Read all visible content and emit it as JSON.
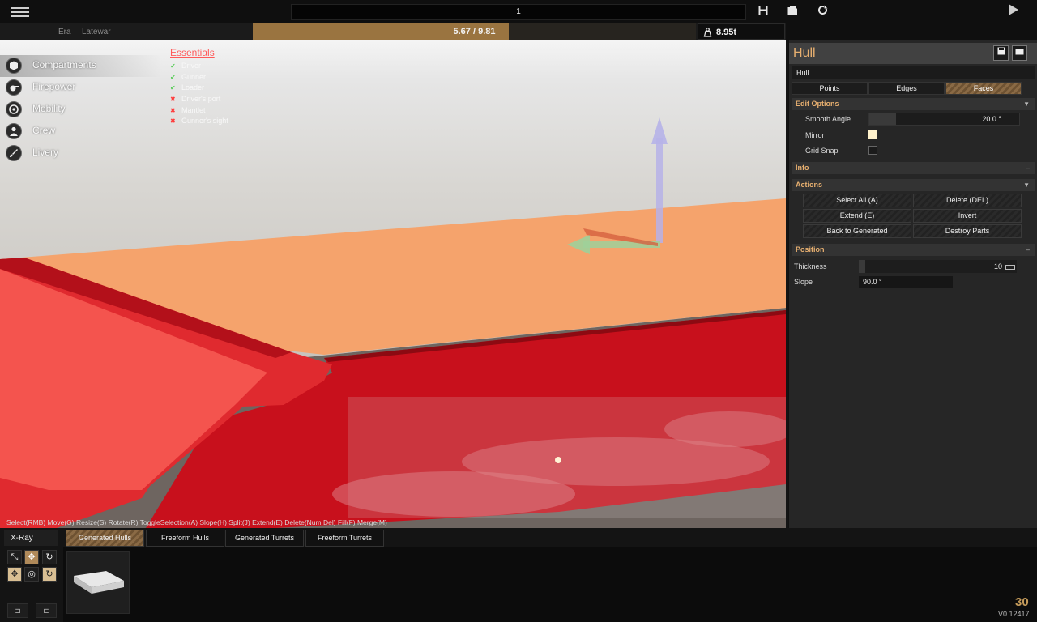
{
  "topbar": {
    "title_value": "1",
    "era_label": "Era",
    "era_value": "Latewar",
    "cost_text": "5.67 / 9.81",
    "cost_fraction": 0.578,
    "weight_text": "8.95t",
    "icons": [
      "menu-icon",
      "save-icon",
      "folder-icon",
      "refresh-icon",
      "play-icon",
      "weight-icon"
    ]
  },
  "left_menu": {
    "items": [
      {
        "label": "Compartments",
        "icon": "compartment-icon",
        "active": true
      },
      {
        "label": "Firepower",
        "icon": "cannon-icon",
        "active": false
      },
      {
        "label": "Mobility",
        "icon": "wheel-icon",
        "active": false
      },
      {
        "label": "Crew",
        "icon": "person-icon",
        "active": false
      },
      {
        "label": "Livery",
        "icon": "brush-icon",
        "active": false
      }
    ]
  },
  "essentials": {
    "title": "Essentials",
    "items": [
      {
        "label": "Driver",
        "ok": true
      },
      {
        "label": "Gunner",
        "ok": true
      },
      {
        "label": "Loader",
        "ok": true
      },
      {
        "label": "Driver's port",
        "ok": false
      },
      {
        "label": "Mantlet",
        "ok": false
      },
      {
        "label": "Gunner's sight",
        "ok": false
      }
    ]
  },
  "hint_bar": "Select(RMB) Move(G) Resize(S) Rotate(R) ToggleSelection(A) Slope(H) Split(J) Extend(E) Delete(Num Del) Fill(F) Merge(M)",
  "panel": {
    "title": "Hull",
    "part_name": "Hull",
    "mode_tabs": [
      "Points",
      "Edges",
      "Faces"
    ],
    "edit_options": {
      "header": "Edit Options",
      "smooth_angle_label": "Smooth Angle",
      "smooth_angle_value": "20.0 °",
      "smooth_angle_fraction": 0.18,
      "mirror_label": "Mirror",
      "mirror_on": true,
      "grid_snap_label": "Grid Snap",
      "grid_snap_on": false
    },
    "info_header": "Info",
    "actions": {
      "header": "Actions",
      "buttons": [
        "Select All (A)",
        "Delete (DEL)",
        "Extend (E)",
        "Invert",
        "Back to Generated",
        "Destroy Parts"
      ]
    },
    "position": {
      "header": "Position",
      "thickness_label": "Thickness",
      "thickness_value": "10",
      "thickness_fraction": 0.04,
      "slope_label": "Slope",
      "slope_value": "90.0 °"
    }
  },
  "bottom": {
    "xray_label": "X-Ray",
    "tabs": [
      "Generated Hulls",
      "Freeform Hulls",
      "Generated Turrets",
      "Freeform Turrets"
    ],
    "fps": "30",
    "version": "V0.12417"
  },
  "colors": {
    "accent": "#e8b070",
    "cost_fill": "#9a7440",
    "hull_orange": "#f5a36c",
    "hull_red": "#c8101c",
    "error_red": "#ff3b3b",
    "ok_green": "#55cc55"
  }
}
